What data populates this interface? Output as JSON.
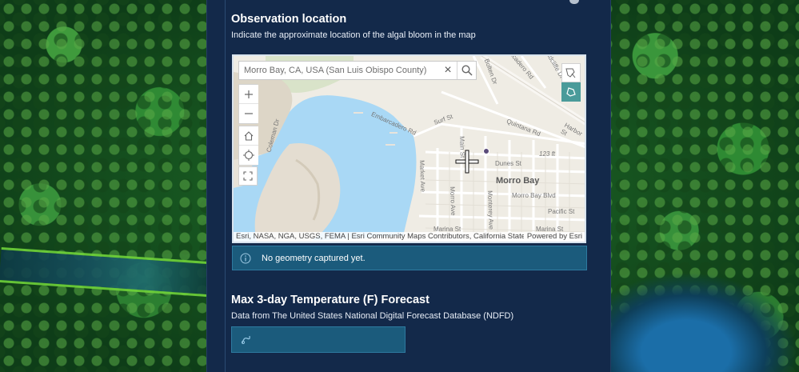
{
  "observation": {
    "title": "Observation location",
    "description": "Indicate the approximate location of the algal bloom in the map"
  },
  "map": {
    "search_value": "Morro Bay, CA, USA (San Luis Obispo County)",
    "attribution_left": "Esri, NASA, NGA, USGS, FEMA | Esri Community Maps Contributors, California State Par...",
    "attribution_right": "Powered by Esri",
    "labels": {
      "city": "Morro Bay",
      "embarcadero": "Embarcadero Rd",
      "surf": "Surf St",
      "quintana": "Quintana Rd",
      "market": "Market Ave",
      "morro": "Morro Ave",
      "monterey": "Monterey Ave",
      "dunes": "Dunes St",
      "morro_bay_blvd": "Morro Bay Blvd",
      "pacific": "Pacific St",
      "marina": "Marina St",
      "marina2": "Marina St",
      "atascadero": "Atascadero Rd",
      "bolten": "Bolten Dr",
      "coleman": "Coleman Dr",
      "radcliffe": "Radcliffe Dr",
      "hwy": "123 ft",
      "main": "Main St",
      "harbor": "Harbor St"
    }
  },
  "notice": {
    "text": "No geometry captured yet."
  },
  "forecast": {
    "title": "Max 3-day Temperature (F) Forecast",
    "description": "Data from The United States National Digital Forecast Database (NDFD)"
  },
  "colors": {
    "panel": "#13294a",
    "accent": "#1b5b7c",
    "water": "#a9d8f5",
    "sketch_active": "#4a9b9a"
  }
}
